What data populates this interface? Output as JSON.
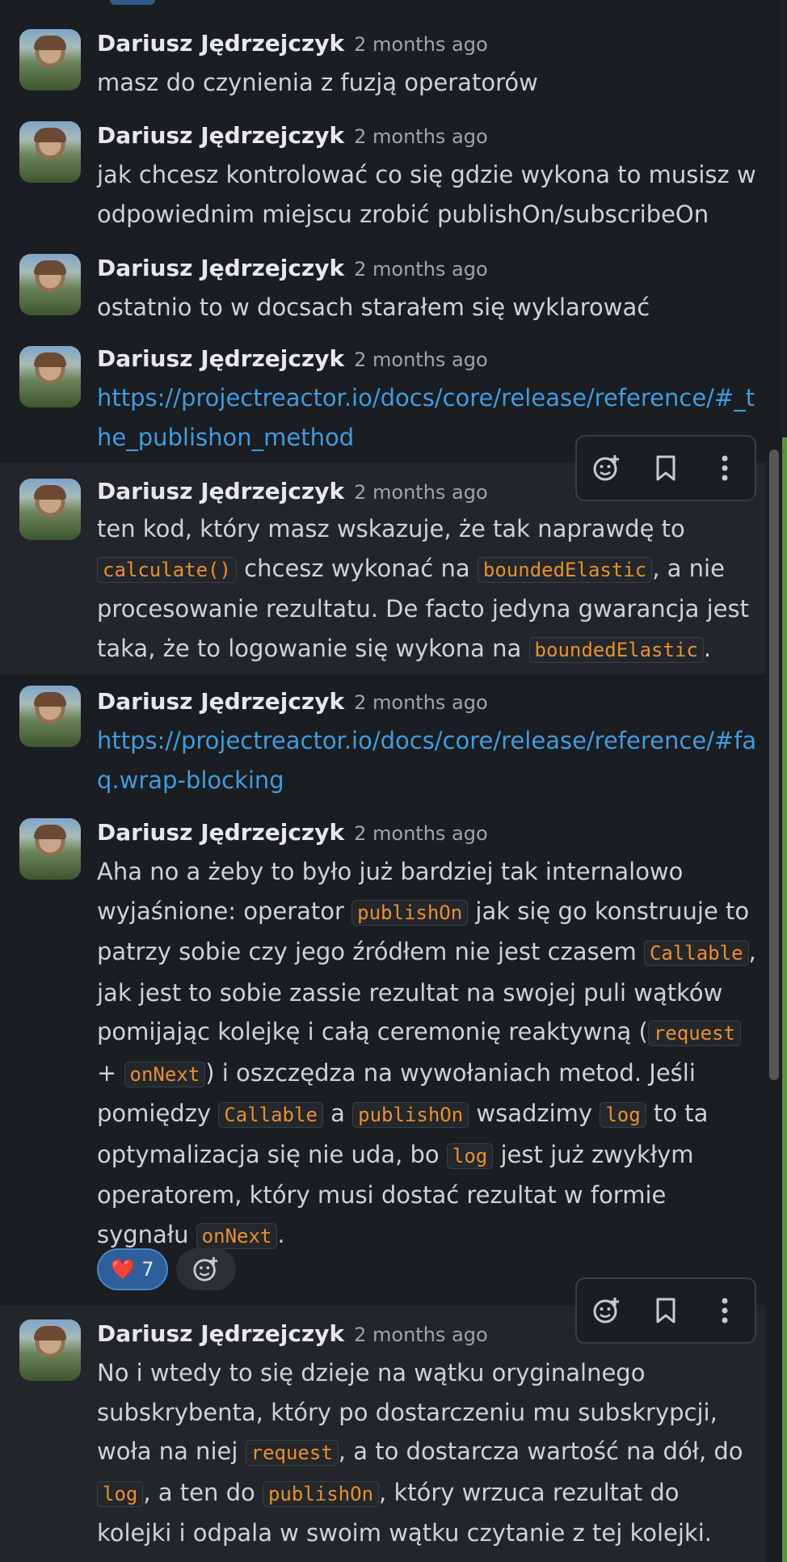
{
  "author": "Dariusz Jędrzejczyk",
  "time": "2 months ago",
  "messages": [
    {
      "text": "masz do czynienia z fuzją operatorów"
    },
    {
      "text": "jak chcesz kontrolować co się gdzie wykona to musisz w odpowiednim miejscu zrobić publishOn/subscribeOn"
    },
    {
      "text": "ostatnio to w docsach starałem się wyklarować"
    },
    {
      "link": "https://projectreactor.io/docs/core/release/reference/#_the_publishon_method"
    },
    {
      "t1": "ten kod, który masz wskazuje, że tak naprawdę to ",
      "c1": "calculate()",
      "t2": " chcesz wykonać na ",
      "c2": "boundedElastic",
      "t3": ", a nie procesowanie rezultatu. De facto jedyna gwarancja jest taka, że to logowanie się wykona na ",
      "c3": "boundedElastic",
      "t4": "."
    },
    {
      "link": "https://projectreactor.io/docs/core/release/reference/#faq.wrap-blocking"
    },
    {
      "t1": "Aha no a żeby to było już bardziej tak internalowo wyjaśnione: operator ",
      "c1": "publishOn",
      "t2": " jak się go konstruuje to patrzy sobie czy jego źródłem nie jest czasem ",
      "c2": "Callable",
      "t3": ", jak jest to sobie zassie rezultat na swojej puli wątków pomijając kolejkę i całą ceremonię reaktywną (",
      "c3": "request",
      "t4": " + ",
      "c4": "onNext",
      "t5": ") i oszczędza na wywołaniach metod. Jeśli pomiędzy ",
      "c5": "Callable",
      "t6": " a ",
      "c6": "publishOn",
      "t7": " wsadzimy ",
      "c7": "log",
      "t8": " to ta optymalizacja się nie uda, bo ",
      "c8": "log",
      "t9": " jest już zwykłym operatorem, który musi dostać rezultat w formie sygnału ",
      "c9": "onNext",
      "t10": ".",
      "reaction_emoji": "❤️",
      "reaction_count": "7"
    },
    {
      "t1": "No i wtedy to się dzieje na wątku oryginalnego subskrybenta, który po dostarczeniu mu subskrypcji, woła na niej ",
      "c1": "request",
      "t2": ", a to dostarcza wartość na dół, do ",
      "c2": "log",
      "t3": ", a ten do ",
      "c3": "publishOn",
      "t4": ", który wrzuca rezultat do kolejki i odpala w swoim wątku czytanie z tej kolejki."
    }
  ],
  "icons": {
    "add_reaction": "add-reaction-icon",
    "bookmark": "bookmark-icon",
    "more": "more-actions-icon"
  }
}
